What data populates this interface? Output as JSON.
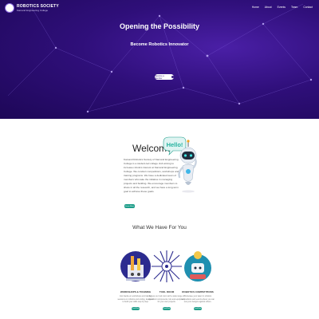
{
  "brand": {
    "name": "ROBOTICS SOCIETY",
    "subtitle": "Kamand Engineering College"
  },
  "nav": {
    "items": [
      "Home",
      "About",
      "Events",
      "Team",
      "Contact"
    ]
  },
  "hero": {
    "title": "Opening the Possibility",
    "subtitle": "Become Robotics Innovator",
    "button_label": "Become a Member",
    "button_icon": "chevron-right-icon",
    "background_color": "#2f0f7a"
  },
  "welcome": {
    "title": "Welcome",
    "body": "Kamand Robotics Society of Kamand Engineering College is a student-led college club aiming to increase robotics interest at Kamand Engineering College. We conduct competitions, workshops and training programs. We have a dedicated team of members who take the initiative in managing projects and building. We encourage members to share in all the research, and we have a long-term goal to achieve these goals.",
    "button_label": "Know More",
    "bubble_text": "Hello!"
  },
  "offerings": {
    "title": "What We Have For You",
    "cards": [
      {
        "title": "WORKSHOPS & TRAINING",
        "description": "Join hands-on workshops and training sessions on robotics and coding, designed to build your skills step by step.",
        "button_label": "Read More"
      },
      {
        "title": "TOOL ROOM",
        "description": "Access our tool room with a wide range of electronic components, kits and equipment for your own projects.",
        "button_label": "Read More"
      },
      {
        "title": "ROBOTICS COMPETITIONS",
        "description": "Showcase your talent in robotics competitions and events where you can test your designs against others.",
        "button_label": "Read More"
      }
    ]
  },
  "colors": {
    "accent": "#1f9e8a",
    "hero_purple": "#2f0f7a"
  }
}
